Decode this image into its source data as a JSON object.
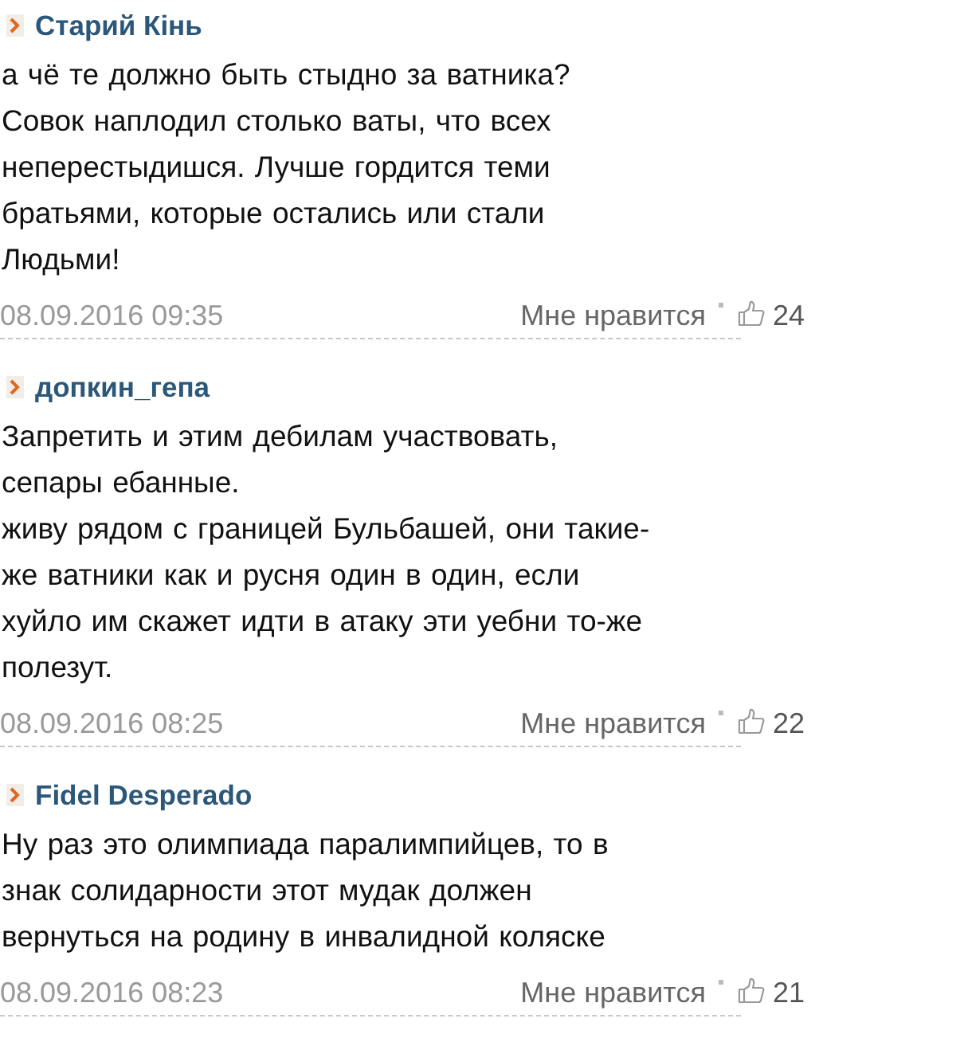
{
  "comments": [
    {
      "author": "Старий Кінь",
      "text": "а чё те должно быть стыдно за ватника?\nСовок наплодил столько ваты, что всех\nнеперестыдишся.  Лучше гордится теми\nбратьями, которые остались или стали\nЛюдьми!",
      "date": "08.09.2016 09:35",
      "like_label": "Мне нравится",
      "likes": "24"
    },
    {
      "author": "допкин_гепа",
      "text": "Запретить и этим дебилам участвовать,\nсепары ебанные.\nживу рядом с границей Бульбашей, они такие-\nже ватники как и русня один в один, если\nхуйло им скажет идти в атаку эти уебни то-же\nполезут.",
      "date": "08.09.2016 08:25",
      "like_label": "Мне нравится",
      "likes": "22"
    },
    {
      "author": "Fidel Desperado",
      "text": "Ну раз это олимпиада паралимпийцев, то в\nзнак солидарности этот мудак должен\nвернуться на родину в инвалидной коляске",
      "date": "08.09.2016 08:23",
      "like_label": "Мне нравится",
      "likes": "21"
    }
  ]
}
